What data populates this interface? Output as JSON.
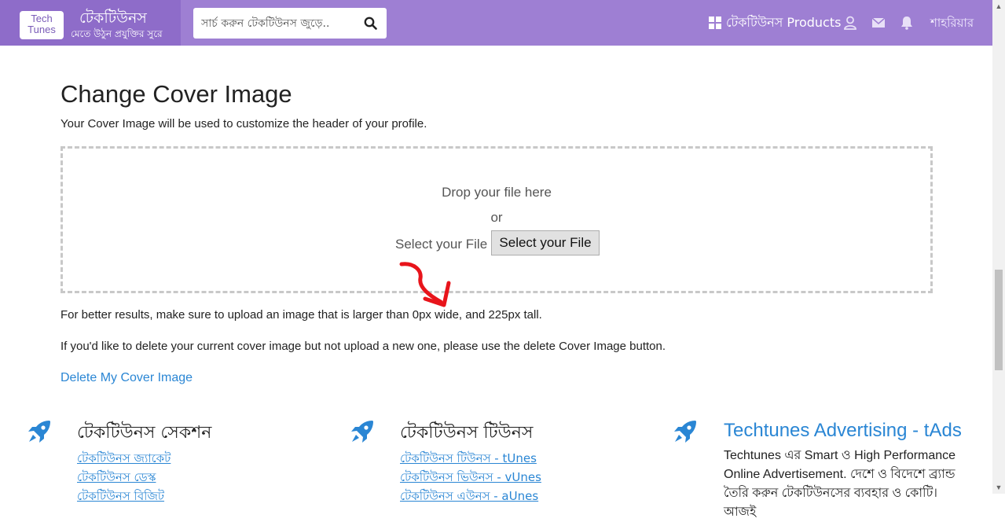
{
  "header": {
    "logo_line1": "Tech",
    "logo_line2": "Tunes",
    "brand_name": "টেকটিউনস",
    "brand_tagline": "মেতে উঠুন প্রযুক্তির সুরে",
    "search_placeholder": "সার্চ করুন টেকটিউনস জুড়ে..",
    "products_label": "টেকটিউনস Products",
    "user_name": "শাহরিয়ার",
    "icons": [
      "search-icon",
      "windows-icon",
      "user-icon",
      "mail-icon",
      "bell-icon"
    ]
  },
  "main": {
    "title": "Change Cover Image",
    "subtitle": "Your Cover Image will be used to customize the header of your profile.",
    "dropzone": {
      "drop_text": "Drop your file here",
      "or_text": "or",
      "select_label": "Select your File",
      "select_button": "Select your File"
    },
    "note_size": "For better results, make sure to upload an image that is larger than 0px wide, and 225px tall.",
    "note_delete": "If you'd like to delete your current cover image but not upload a new one, please use the delete Cover Image button.",
    "delete_link": "Delete My Cover Image"
  },
  "footer": {
    "col1": {
      "title": "টেকটিউনস সেকশন",
      "links": [
        "টেকটিউনস জ্যাকেট",
        "টেকটিউনস ডেস্ক",
        "টেকটিউনস বিজিট"
      ]
    },
    "col2": {
      "title": "টেকটিউনস টিউনস",
      "links": [
        "টেকটিউনস টিউনস - tUnes",
        "টেকটিউনস ভিউনস - vUnes",
        "টেকটিউনস এউনস - aUnes"
      ]
    },
    "col3": {
      "title": "Techtunes Advertising - tAds",
      "text_line1": "Techtunes এর Smart ও High Performance",
      "text_line2": "Online Advertisement. দেশে ও বিদেশে ব্র্যান্ড",
      "text_line3": "তৈরি করুন টেকটিউনসের ব্যবহার ও কোটি। আজই"
    }
  },
  "colors": {
    "header_bg": "#9e7fd3",
    "brand_bg": "#8e6cc9",
    "link": "#2a86d4",
    "annotation_arrow": "#e8141b"
  }
}
